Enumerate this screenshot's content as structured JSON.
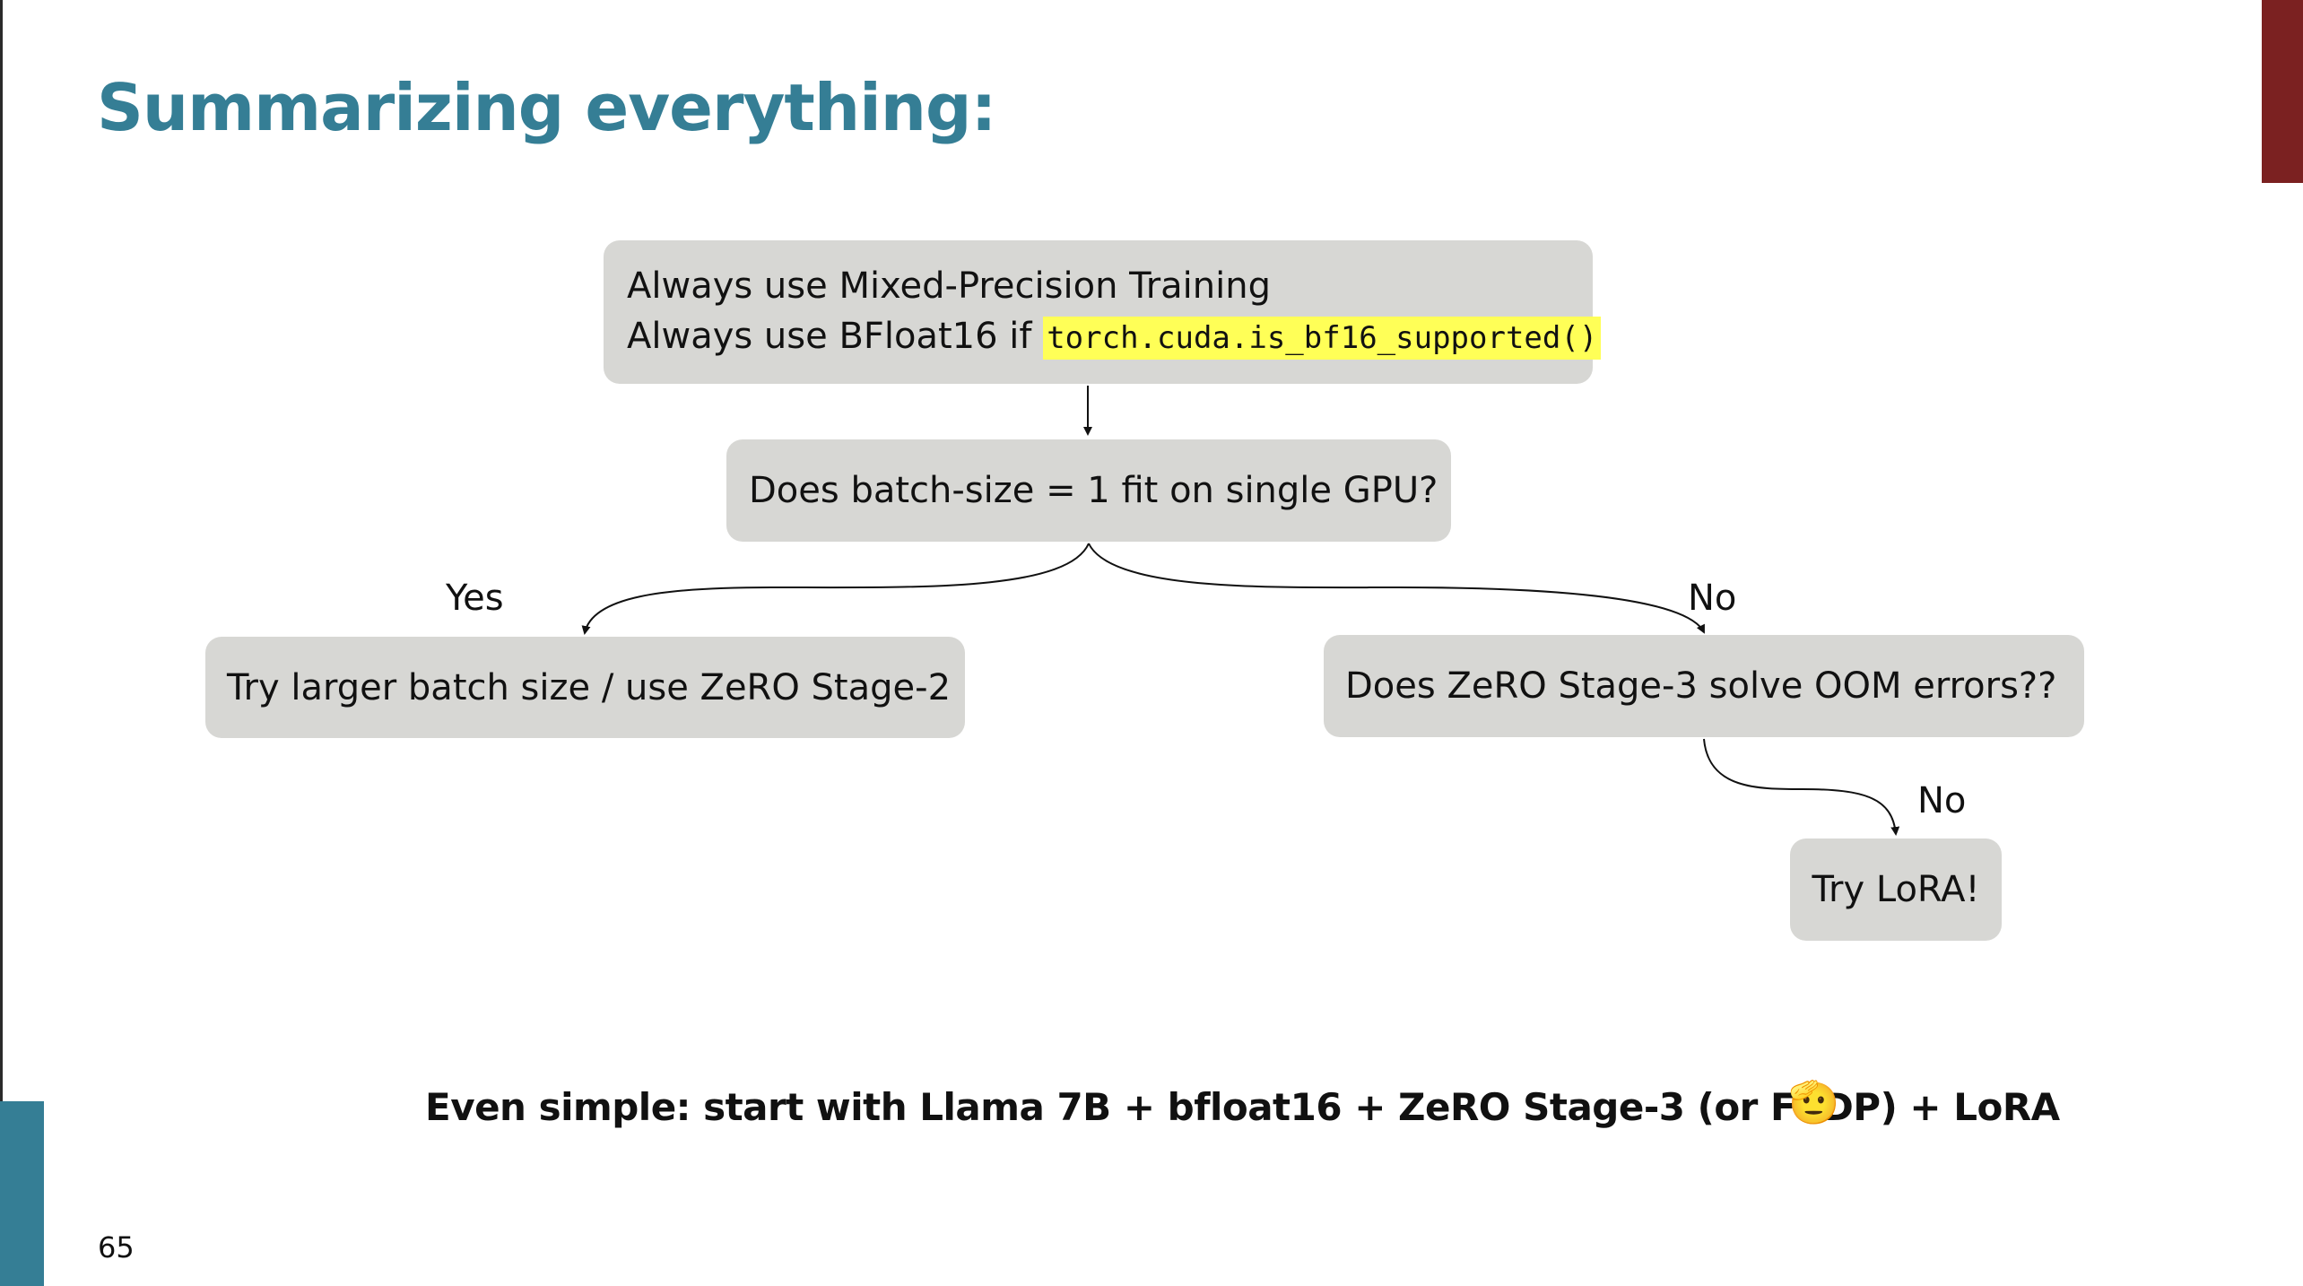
{
  "slide": {
    "title": "Summarizing everything:",
    "page_number": "65",
    "colors": {
      "title": "#357e95",
      "accent_top_right": "#7b2121",
      "accent_bottom_left": "#357e95",
      "box_fill": "#d7d7d4",
      "code_highlight": "#ffff57"
    }
  },
  "flow": {
    "top_box": {
      "line1": "Always use Mixed-Precision Training",
      "line2_prefix": "Always use BFloat16 if",
      "line2_code": "torch.cuda.is_bf16_supported()"
    },
    "question1": "Does batch-size = 1 fit on single GPU?",
    "yes_label": "Yes",
    "yes_action": "Try larger batch size / use ZeRO Stage-2",
    "no_label": "No",
    "question2": "Does ZeRO Stage-3 solve OOM errors??",
    "no2_label": "No",
    "no2_action": "Try LoRA!"
  },
  "footer": {
    "note": "Even simple: start with Llama 7B + bfloat16 + ZeRO Stage-3 (or FSDP) + LoRA",
    "emoji": "🫡",
    "emoji_icon": "saluting-face-icon"
  }
}
